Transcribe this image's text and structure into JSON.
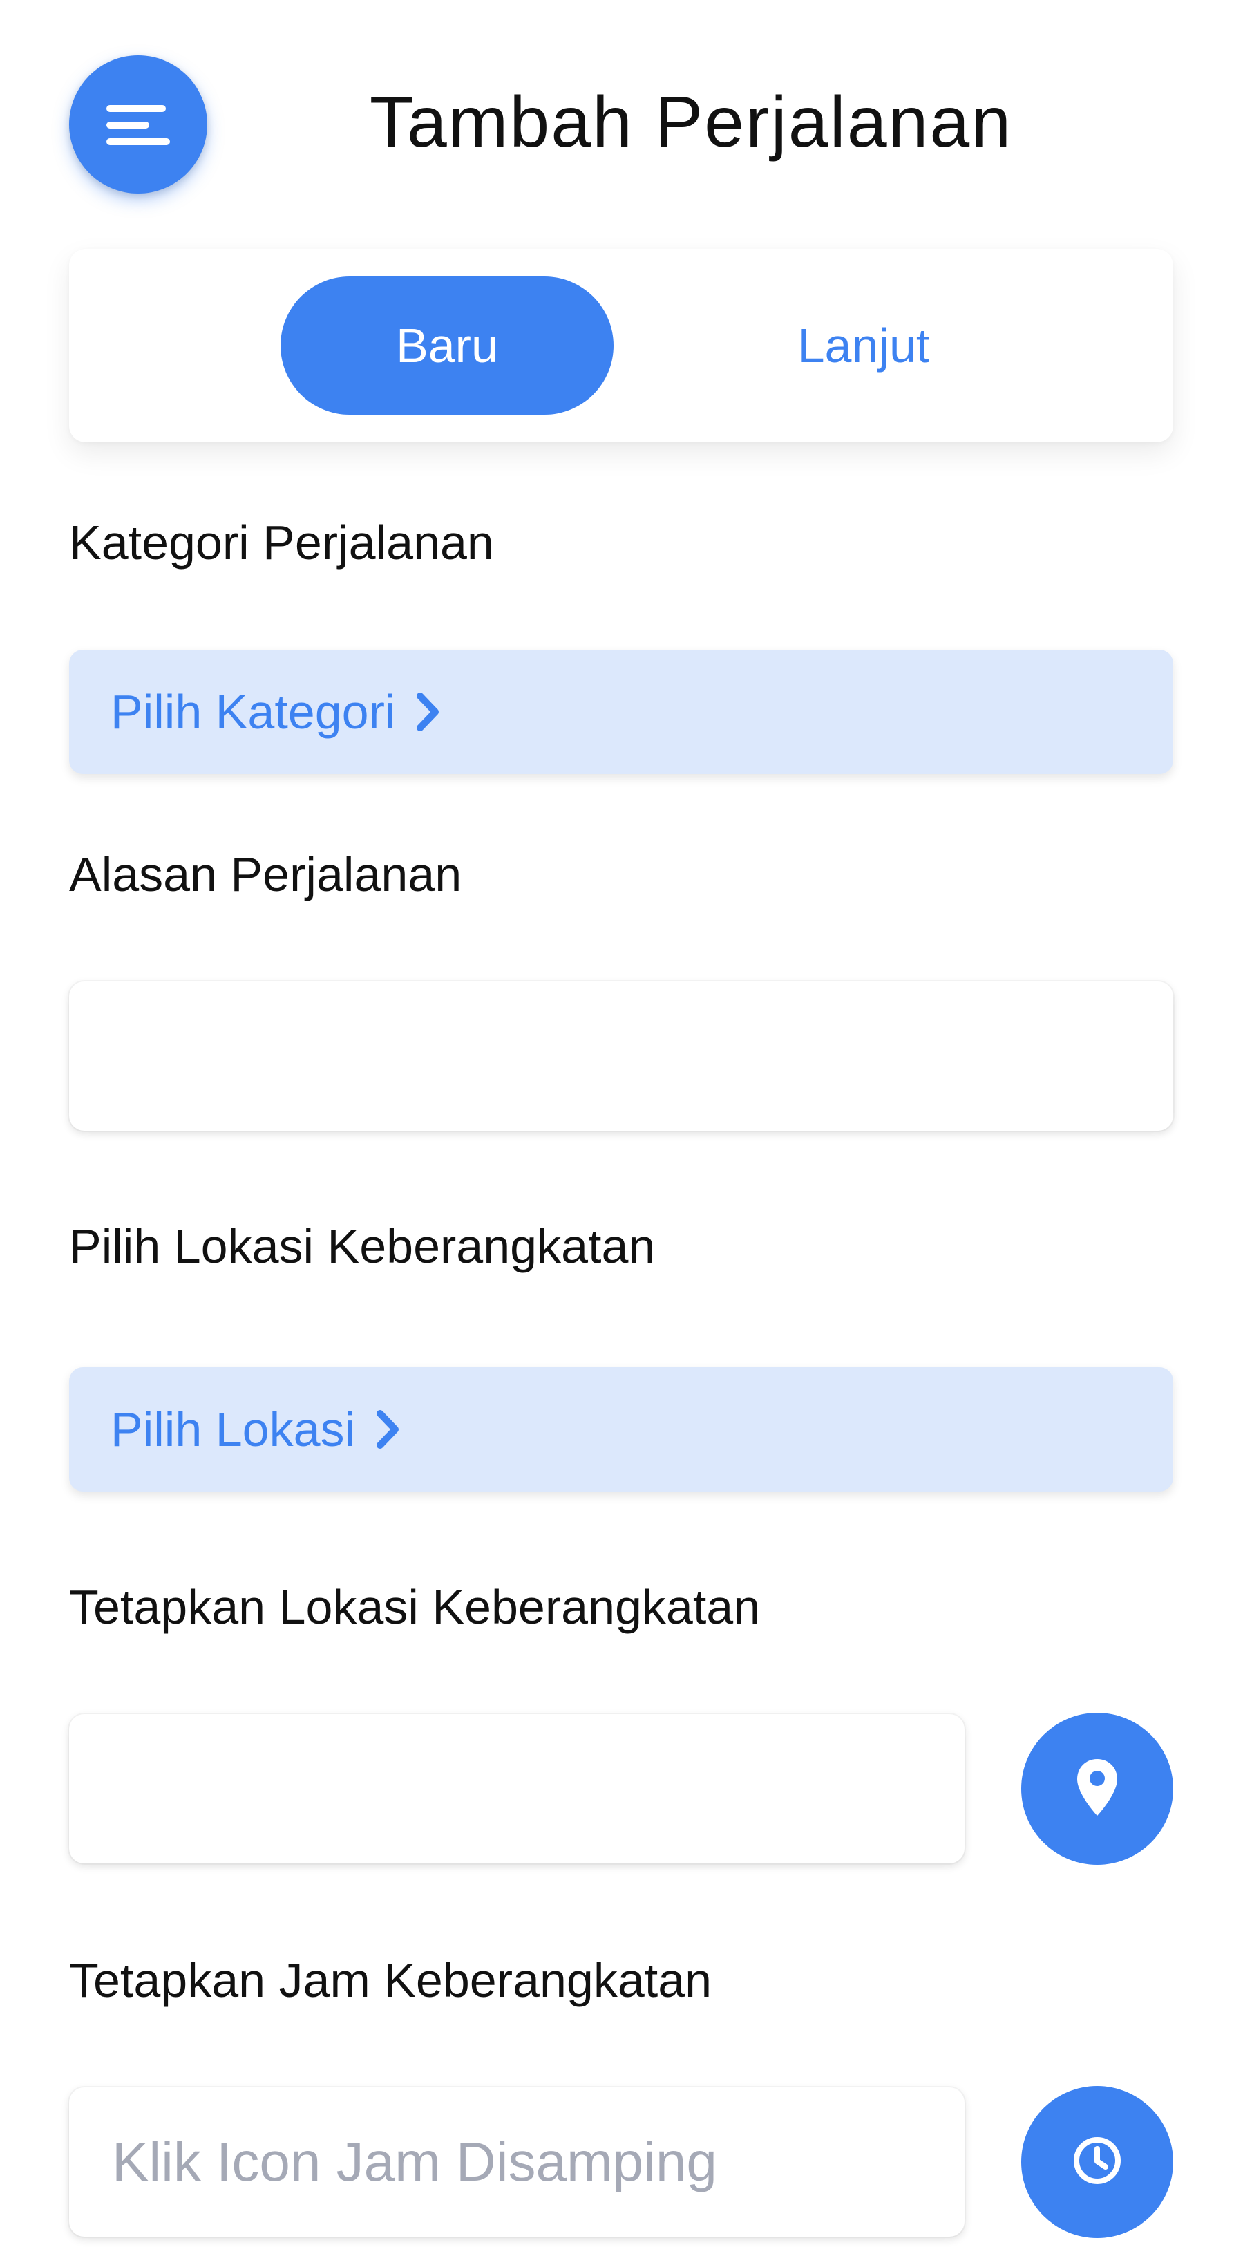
{
  "header": {
    "title": "Tambah Perjalanan",
    "menu_icon": "hamburger-menu-icon"
  },
  "tabs": [
    {
      "label": "Baru",
      "active": true
    },
    {
      "label": "Lanjut",
      "active": false
    }
  ],
  "form": {
    "category": {
      "label": "Kategori Perjalanan",
      "picker_text": "Pilih Kategori",
      "icon": "chevron-right-icon"
    },
    "reason": {
      "label": "Alasan Perjalanan",
      "value": "",
      "placeholder": ""
    },
    "departure_location_choice": {
      "label": "Pilih Lokasi Keberangkatan",
      "picker_text": "Pilih Lokasi",
      "icon": "chevron-right-icon"
    },
    "departure_location_set": {
      "label": "Tetapkan Lokasi Keberangkatan",
      "value": "",
      "placeholder": "",
      "button_icon": "map-pin-icon"
    },
    "departure_time": {
      "label": "Tetapkan Jam Keberangkatan",
      "value": "",
      "placeholder": "Klik Icon Jam Disamping",
      "button_icon": "clock-icon"
    }
  },
  "colors": {
    "accent": "#3D82F1",
    "picker_bg": "#DCE8FC",
    "placeholder": "#A5A9B6"
  }
}
